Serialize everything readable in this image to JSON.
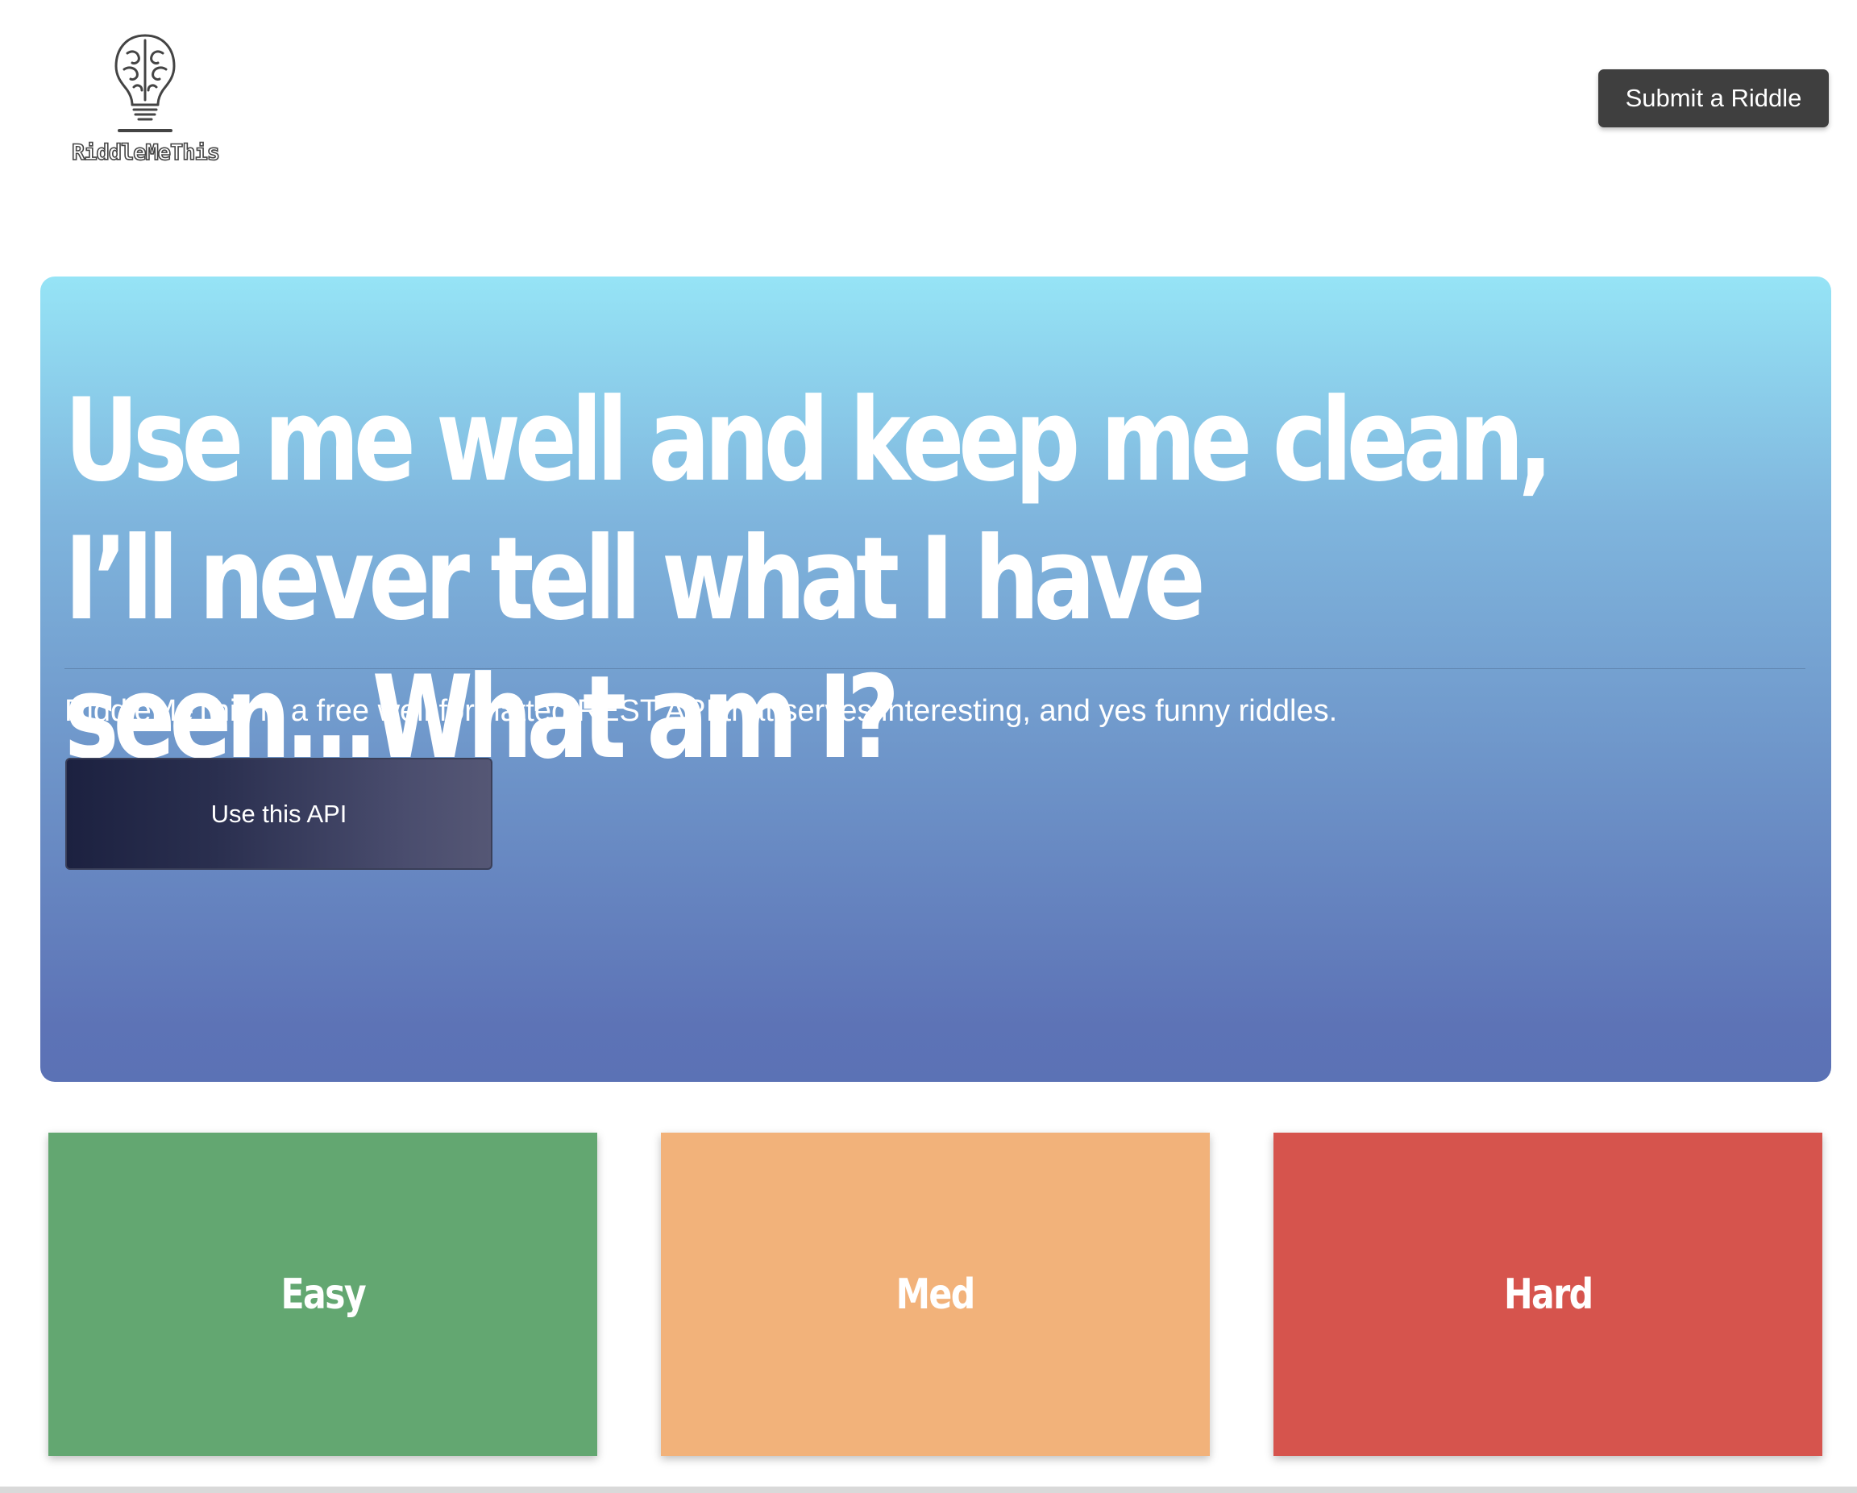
{
  "header": {
    "logo_text": "RiddleMeThis",
    "submit_label": "Submit a Riddle"
  },
  "hero": {
    "riddle": "Use me well and keep me clean, I’ll never tell what I have seen...What am I?",
    "lead": "RiddleMeThis is a free well formatted REST API that serves interesting, and yes funny riddles.",
    "cta_label": "Use this API",
    "gradient": [
      "#96e4f6",
      "#5b72b5"
    ]
  },
  "difficulties": [
    {
      "label": "Easy",
      "color": "#63a771"
    },
    {
      "label": "Med",
      "color": "#f2b27a"
    },
    {
      "label": "Hard",
      "color": "#d6544d"
    }
  ],
  "icons": {
    "logo": "lightbulb-brain-icon"
  }
}
